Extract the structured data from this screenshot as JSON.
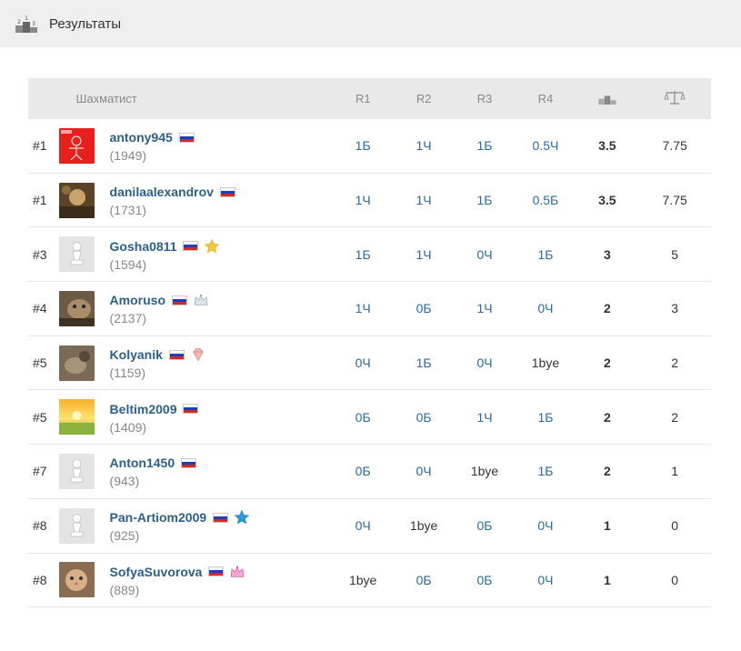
{
  "header": {
    "title": "Результаты"
  },
  "table": {
    "columns": {
      "player": "Шахматист",
      "r1": "R1",
      "r2": "R2",
      "r3": "R3",
      "r4": "R4"
    },
    "rows": [
      {
        "rank": "#1",
        "name": "antony945",
        "rating": "(1949)",
        "badge": "",
        "r": [
          "1Б",
          "1Ч",
          "1Б",
          "0.5Ч"
        ],
        "points": "3.5",
        "tiebreak": "7.75",
        "avatar": "red-drawing"
      },
      {
        "rank": "#1",
        "name": "danilaalexandrov",
        "rating": "(1731)",
        "badge": "",
        "r": [
          "1Ч",
          "1Ч",
          "1Б",
          "0.5Б"
        ],
        "points": "3.5",
        "tiebreak": "7.75",
        "avatar": "photo-brown"
      },
      {
        "rank": "#3",
        "name": "Gosha0811",
        "rating": "(1594)",
        "badge": "star-gold",
        "r": [
          "1Б",
          "1Ч",
          "0Ч",
          "1Б"
        ],
        "points": "3",
        "tiebreak": "5",
        "avatar": "pawn"
      },
      {
        "rank": "#4",
        "name": "Amoruso",
        "rating": "(2137)",
        "badge": "crown-silver",
        "r": [
          "1Ч",
          "0Б",
          "1Ч",
          "0Ч"
        ],
        "points": "2",
        "tiebreak": "3",
        "avatar": "photo-cat"
      },
      {
        "rank": "#5",
        "name": "Kolyanik",
        "rating": "(1159)",
        "badge": "diamond",
        "r": [
          "0Ч",
          "1Б",
          "0Ч",
          "1bye"
        ],
        "points": "2",
        "tiebreak": "2",
        "avatar": "photo-dark"
      },
      {
        "rank": "#5",
        "name": "Beltim2009",
        "rating": "(1409)",
        "badge": "",
        "r": [
          "0Б",
          "0Б",
          "1Ч",
          "1Б"
        ],
        "points": "2",
        "tiebreak": "2",
        "avatar": "photo-sunset"
      },
      {
        "rank": "#7",
        "name": "Anton1450",
        "rating": "(943)",
        "badge": "",
        "r": [
          "0Б",
          "0Ч",
          "1bye",
          "1Б"
        ],
        "points": "2",
        "tiebreak": "1",
        "avatar": "pawn"
      },
      {
        "rank": "#8",
        "name": "Pan-Artiom2009",
        "rating": "(925)",
        "badge": "star-blue",
        "r": [
          "0Ч",
          "1bye",
          "0Б",
          "0Ч"
        ],
        "points": "1",
        "tiebreak": "0",
        "avatar": "pawn"
      },
      {
        "rank": "#8",
        "name": "SofyaSuvorova",
        "rating": "(889)",
        "badge": "crown-pink",
        "r": [
          "1bye",
          "0Б",
          "0Б",
          "0Ч"
        ],
        "points": "1",
        "tiebreak": "0",
        "avatar": "photo-cat2"
      }
    ]
  },
  "colors": {
    "link": "#2c6aa0",
    "name": "#2c5f8a",
    "header_bg": "#efefef",
    "thead_bg": "#e9e9e9"
  }
}
